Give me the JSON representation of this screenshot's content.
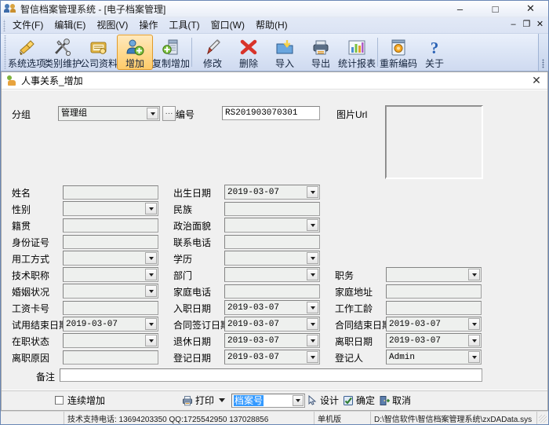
{
  "window": {
    "title": "智信档案管理系统 - [电子档案管理]",
    "icon": "app-people-icon",
    "minimize": "–",
    "maximize": "□",
    "close": "✕"
  },
  "menubar": {
    "items": [
      {
        "label": "文件(F)"
      },
      {
        "label": "编辑(E)"
      },
      {
        "label": "视图(V)"
      },
      {
        "label": "操作"
      },
      {
        "label": "工具(T)"
      },
      {
        "label": "窗口(W)"
      },
      {
        "label": "帮助(H)"
      }
    ],
    "mdi_minimize": "–",
    "mdi_restore": "❐",
    "mdi_close": "✕"
  },
  "toolbar": {
    "buttons": [
      {
        "label": "系统选项",
        "icon": "plug-icon",
        "active": false
      },
      {
        "label": "类别维护",
        "icon": "tools-icon",
        "active": false
      },
      {
        "label": "公司资料",
        "icon": "book-icon",
        "active": false
      },
      {
        "label": "增加",
        "icon": "add-user-icon",
        "active": true
      },
      {
        "label": "复制增加",
        "icon": "copy-add-icon",
        "active": false
      },
      {
        "label": "修改",
        "icon": "pencil-icon",
        "active": false
      },
      {
        "label": "删除",
        "icon": "delete-x-icon",
        "active": false
      },
      {
        "label": "导入",
        "icon": "import-icon",
        "active": false
      },
      {
        "label": "导出",
        "icon": "export-printer-icon",
        "active": false
      },
      {
        "label": "统计报表",
        "icon": "chart-bars-icon",
        "active": false
      },
      {
        "label": "重新编码",
        "icon": "recode-icon",
        "active": false
      },
      {
        "label": "关于",
        "icon": "question-mark-icon",
        "active": false
      }
    ]
  },
  "child_window": {
    "title": "人事关系_增加",
    "icon": "person-add-icon",
    "close": "✕"
  },
  "form": {
    "header": {
      "group_label": "分组",
      "group_value": "管理组",
      "group_picker_label": "···",
      "number_label": "编号",
      "number_value": "RS201903070301",
      "picture_label": "图片Url"
    },
    "fields_col1": [
      {
        "label": "姓名",
        "value": "",
        "type": "text"
      },
      {
        "label": "性别",
        "value": "",
        "type": "combo"
      },
      {
        "label": "籍贯",
        "value": "",
        "type": "text"
      },
      {
        "label": "身份证号",
        "value": "",
        "type": "text"
      },
      {
        "label": "用工方式",
        "value": "",
        "type": "combo"
      },
      {
        "label": "技术职称",
        "value": "",
        "type": "combo"
      },
      {
        "label": "婚姻状况",
        "value": "",
        "type": "combo"
      },
      {
        "label": "工资卡号",
        "value": "",
        "type": "text"
      },
      {
        "label": "试用结束日期",
        "value": "2019-03-07",
        "type": "combo"
      },
      {
        "label": "在职状态",
        "value": "",
        "type": "combo"
      },
      {
        "label": "离职原因",
        "value": "",
        "type": "text"
      }
    ],
    "fields_col2": [
      {
        "label": "出生日期",
        "value": "2019-03-07",
        "type": "combo"
      },
      {
        "label": "民族",
        "value": "",
        "type": "text"
      },
      {
        "label": "政治面貌",
        "value": "",
        "type": "combo"
      },
      {
        "label": "联系电话",
        "value": "",
        "type": "text"
      },
      {
        "label": "学历",
        "value": "",
        "type": "combo"
      },
      {
        "label": "部门",
        "value": "",
        "type": "combo"
      },
      {
        "label": "家庭电话",
        "value": "",
        "type": "text"
      },
      {
        "label": "入职日期",
        "value": "2019-03-07",
        "type": "combo"
      },
      {
        "label": "合同签订日期",
        "value": "2019-03-07",
        "type": "combo"
      },
      {
        "label": "退休日期",
        "value": "2019-03-07",
        "type": "combo"
      },
      {
        "label": "登记日期",
        "value": "2019-03-07",
        "type": "combo"
      }
    ],
    "fields_col3": [
      {
        "label": "职务",
        "value": "",
        "type": "combo",
        "row": 5
      },
      {
        "label": "家庭地址",
        "value": "",
        "type": "text",
        "row": 6
      },
      {
        "label": "工作工龄",
        "value": "",
        "type": "text",
        "row": 7
      },
      {
        "label": "合同结束日期",
        "value": "2019-03-07",
        "type": "combo",
        "row": 8
      },
      {
        "label": "离职日期",
        "value": "2019-03-07",
        "type": "combo",
        "row": 9
      },
      {
        "label": "登记人",
        "value": "Admin",
        "type": "combo",
        "row": 10
      }
    ],
    "remark": {
      "label": "备注",
      "value": ""
    }
  },
  "buttonbar": {
    "continuous_add_label": "连续增加",
    "continuous_add_checked": false,
    "print_label": "打印",
    "print_icon": "printer-icon",
    "template_value": "档案号",
    "design_label": "设计",
    "design_icon": "design-pointer-icon",
    "ok_label": "确定",
    "ok_icon": "ok-check-icon",
    "cancel_label": "取消",
    "cancel_icon": "cancel-door-icon"
  },
  "statusbar": {
    "support": "技术支持电话: 13694203350 QQ:1725542950 137028856",
    "mode": "单机版",
    "path": "D:\\智信软件\\智信档案管理系统\\zxDAData.sys"
  },
  "colors": {
    "accent": "#3399ff",
    "toolbar_active": "#ffcb6a",
    "titlebar": "#f2f5fb",
    "form_bg": "#f0f0f0"
  }
}
